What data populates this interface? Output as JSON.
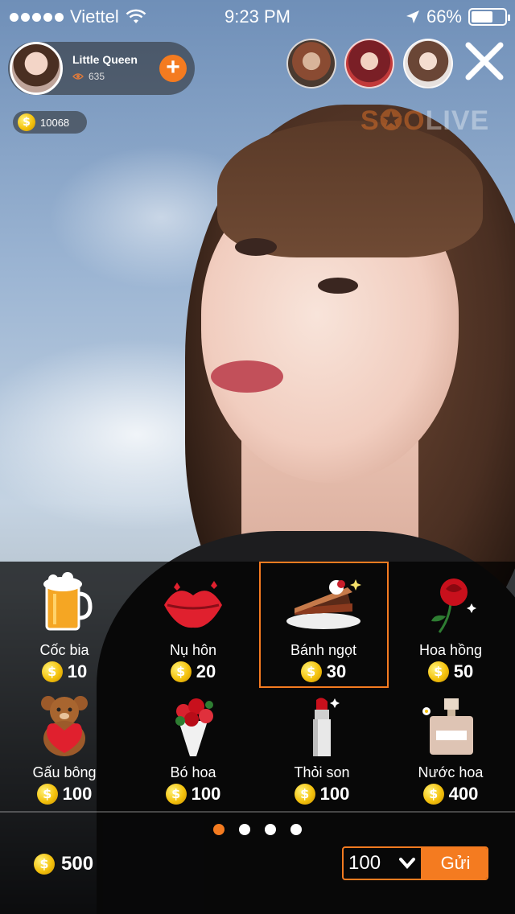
{
  "status_bar": {
    "carrier": "Viettel",
    "time": "9:23 PM",
    "battery": "66%",
    "battery_level": 0.66
  },
  "host": {
    "name": "Little Queen",
    "views": "635"
  },
  "coins": {
    "amount": "10068"
  },
  "watermark": {
    "prefix": "S",
    "middle": "✪O",
    "suffix": "LIVE"
  },
  "gifts": [
    {
      "label": "Cốc bia",
      "price": "10",
      "icon": "beer-icon"
    },
    {
      "label": "Nụ hôn",
      "price": "20",
      "icon": "lips-icon"
    },
    {
      "label": "Bánh ngọt",
      "price": "30",
      "icon": "cake-icon",
      "selected": true
    },
    {
      "label": "Hoa hồng",
      "price": "50",
      "icon": "rose-icon"
    },
    {
      "label": "Gấu bông",
      "price": "100",
      "icon": "teddy-bear-icon"
    },
    {
      "label": "Bó hoa",
      "price": "100",
      "icon": "bouquet-icon"
    },
    {
      "label": "Thỏi son",
      "price": "100",
      "icon": "lipstick-icon"
    },
    {
      "label": "Nước hoa",
      "price": "400",
      "icon": "perfume-icon"
    }
  ],
  "pager": {
    "pages": 4,
    "active": 1
  },
  "footer": {
    "balance": "500",
    "quantity": "100",
    "send_label": "Gửi"
  },
  "colors": {
    "accent": "#f47b20"
  }
}
